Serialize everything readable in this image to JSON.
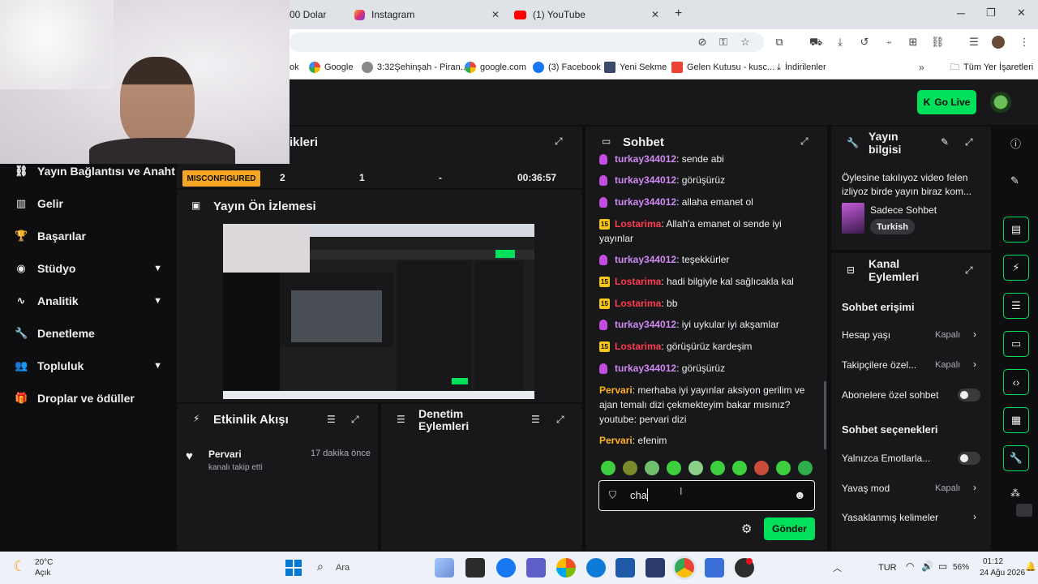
{
  "browser": {
    "tabs": [
      {
        "label": "00 Dolar"
      },
      {
        "label": "Instagram"
      },
      {
        "label": "(1) YouTube"
      }
    ],
    "close_glyph": "✕",
    "new_tab_glyph": "+",
    "bookmarks": [
      {
        "label": "ok"
      },
      {
        "label": "Google"
      },
      {
        "label": "3:32Şehinşah - Piran..."
      },
      {
        "label": "google.com"
      },
      {
        "label": "(3) Facebook"
      },
      {
        "label": "Yeni Sekme"
      },
      {
        "label": "Gelen Kutusu - kusc..."
      },
      {
        "label": "İndirilenler"
      },
      {
        "label": "Tüm Yer İşaretleri"
      }
    ]
  },
  "header": {
    "go_live_label": "Go Live"
  },
  "sidebar": {
    "items": [
      {
        "label": "Yayın Bağlantısı ve Anahtarı",
        "icon": "link-icon"
      },
      {
        "label": "Gelir",
        "icon": "chart-icon"
      },
      {
        "label": "Başarılar",
        "icon": "trophy-icon"
      },
      {
        "label": "Stüdyo",
        "icon": "camera-icon"
      },
      {
        "label": "Analitik",
        "icon": "pulse-icon"
      },
      {
        "label": "Denetleme",
        "icon": "wrench-icon"
      },
      {
        "label": "Topluluk",
        "icon": "people-icon"
      },
      {
        "label": "Droplar ve ödüller",
        "icon": "gift-icon"
      }
    ]
  },
  "stats_panel": {
    "title": "ikleri",
    "status_badge": "MISCONFIGURED",
    "col1": "2",
    "col2": "1",
    "col3": "-",
    "col4": "00:36:57"
  },
  "preview": {
    "title": "Yayın Ön İzlemesi"
  },
  "activity": {
    "title": "Etkinlik Akışı",
    "events": [
      {
        "name": "Pervari",
        "action": "kanalı takip etti",
        "time": "17 dakika önce"
      }
    ]
  },
  "mod_actions": {
    "title_line1": "Denetim",
    "title_line2": "Eylemleri"
  },
  "chat": {
    "title": "Sohbet",
    "messages": [
      {
        "user": "turkay344012",
        "text": "sende abi",
        "badge": "mic"
      },
      {
        "user": "turkay344012",
        "text": "görüşürüz",
        "badge": "mic"
      },
      {
        "user": "turkay344012",
        "text": "allaha emanet ol",
        "badge": "mic"
      },
      {
        "user": "Lostarima",
        "text": "Allah'a emanet ol sende iyi yayınlar",
        "badge": "15"
      },
      {
        "user": "turkay344012",
        "text": "teşekkürler",
        "badge": "mic"
      },
      {
        "user": "Lostarima",
        "text": "hadi bilgiyle kal sağlıcakla kal",
        "badge": "15"
      },
      {
        "user": "Lostarima",
        "text": "bb",
        "badge": "15"
      },
      {
        "user": "turkay344012",
        "text": "iyi uykular iyi akşamlar",
        "badge": "mic"
      },
      {
        "user": "Lostarima",
        "text": "görüşürüz kardeşim",
        "badge": "15"
      },
      {
        "user": "turkay344012",
        "text": "görüşürüz",
        "badge": "mic"
      },
      {
        "user": "Pervari",
        "text": "merhaba iyi yayınlar aksiyon gerilim ve ajan temalı dizi çekmekteyim bakar mısınız? youtube: pervari dizi",
        "badge": ""
      },
      {
        "user": "Pervari",
        "text": "efenim",
        "badge": ""
      }
    ],
    "input_value": "cha",
    "send_label": "Gönder"
  },
  "stream_info": {
    "title_line1": "Yayın",
    "title_line2": "bilgisi",
    "stream_title": "Öylesine takılıyoz video felen izliyoz birde yayın biraz kom...",
    "category": "Sadece Sohbet",
    "tag": "Turkish"
  },
  "channel_actions": {
    "title_line1": "Kanal",
    "title_line2": "Eylemleri",
    "chat_access_heading": "Sohbet erişimi",
    "account_age_label": "Hesap yaşı",
    "account_age_value": "Kapalı",
    "followers_label": "Takipçilere özel...",
    "followers_value": "Kapalı",
    "subs_label": "Abonelere özel sohbet",
    "chat_options_heading": "Sohbet seçenekleri",
    "emote_only_label": "Yalnızca Emotlarla...",
    "slow_mode_label": "Yavaş mod",
    "slow_mode_value": "Kapalı",
    "banned_words_label": "Yasaklanmış kelimeler"
  },
  "taskbar": {
    "weather_temp": "20°C",
    "weather_desc": "Açık",
    "search_label": "Ara",
    "language": "TUR",
    "battery": "56%",
    "time": "01:12",
    "date": "24 Ağu 2026"
  },
  "colors": {
    "accent": "#00e05a",
    "misconfigured": "#f5a623",
    "panel": "#18181b"
  }
}
